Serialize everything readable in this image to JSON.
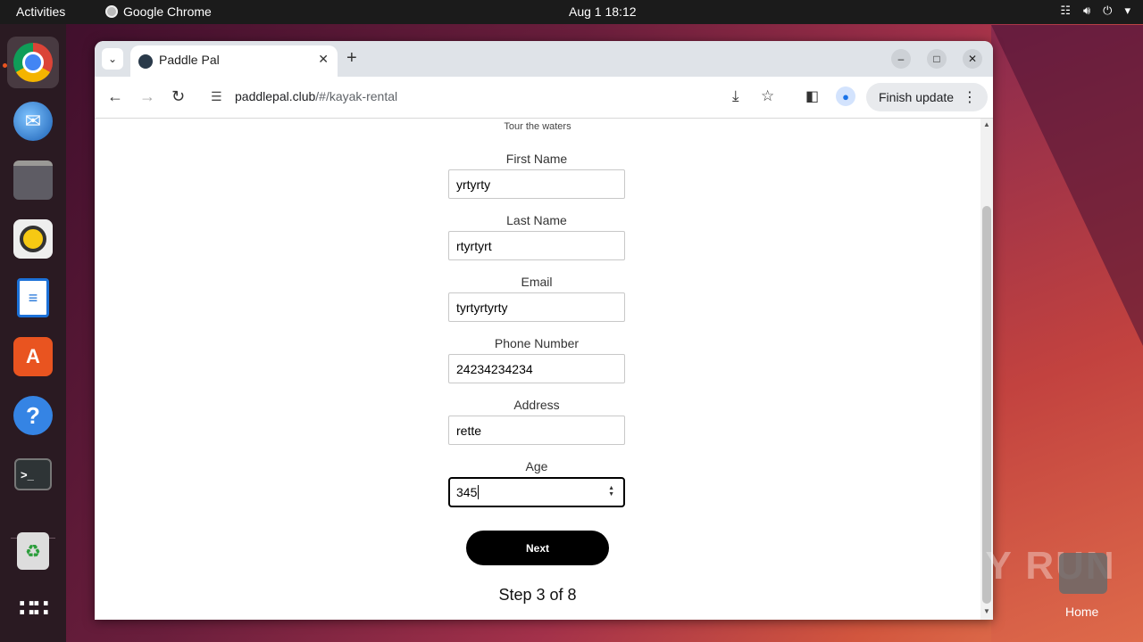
{
  "topbar": {
    "activities": "Activities",
    "app_name": "Google Chrome",
    "clock": "Aug 1  18:12"
  },
  "dock": {
    "items": [
      "chrome-icon",
      "thunderbird-icon",
      "files-icon",
      "rhythmbox-icon",
      "writer-icon",
      "app-center-icon",
      "help-icon",
      "terminal-icon",
      "trash-icon",
      "app-grid-icon"
    ]
  },
  "browser": {
    "tab_title": "Paddle Pal",
    "url_host": "paddlepal.club",
    "url_path": "/#/kayak-rental",
    "update_label": "Finish update"
  },
  "page": {
    "tagline": "Tour the waters",
    "fields": [
      {
        "label": "First Name",
        "value": "yrtyrty"
      },
      {
        "label": "Last Name",
        "value": "rtyrtyrt"
      },
      {
        "label": "Email",
        "value": "tyrtyrtyrty"
      },
      {
        "label": "Phone Number",
        "value": "24234234234"
      },
      {
        "label": "Address",
        "value": "rette"
      },
      {
        "label": "Age",
        "value": "345"
      }
    ],
    "next_label": "Next",
    "step_text": "Step 3 of 8"
  },
  "desktop": {
    "watermark": "ANY RUN",
    "home_label": "Home"
  },
  "colors": {
    "ubuntu_accent": "#e95420",
    "button_bg": "#000000"
  }
}
